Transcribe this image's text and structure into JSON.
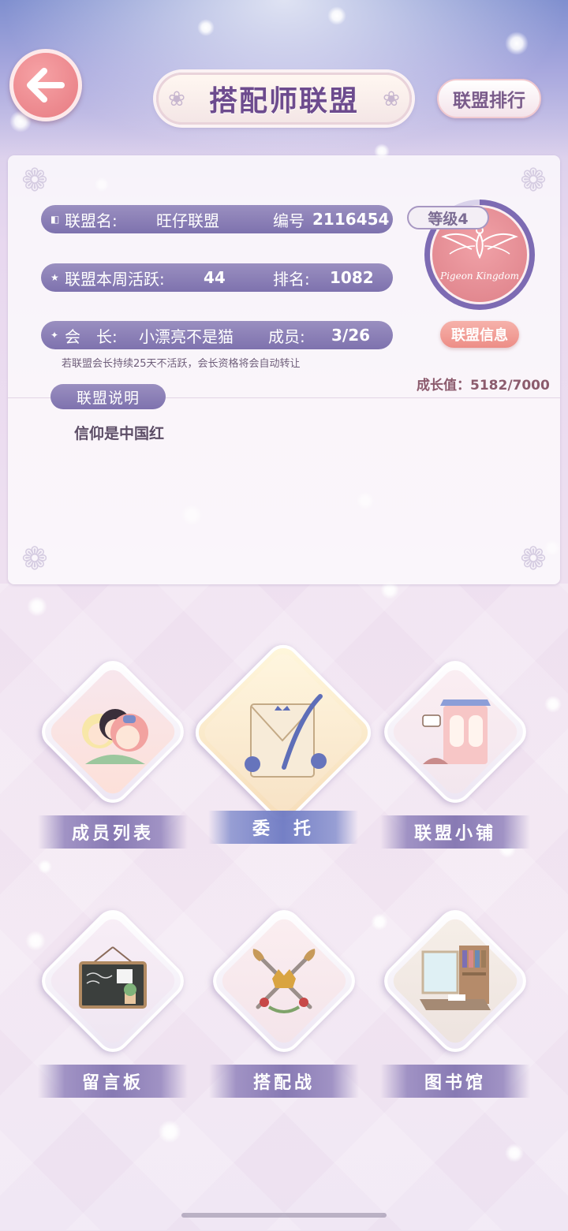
{
  "header": {
    "title": "搭配师联盟",
    "rank_button": "联盟排行"
  },
  "alliance": {
    "name_label": "联盟名:",
    "name_value": "旺仔联盟",
    "id_label": "编号",
    "id_value": "2116454",
    "weekly_label": "联盟本周活跃:",
    "weekly_value": "44",
    "rank_label": "排名:",
    "rank_value": "1082",
    "leader_label": "会　长:",
    "leader_value": "小漂亮不是猫",
    "members_label": "成员:",
    "members_value": "3/26",
    "note": "若联盟会长持续25天不活跃，会长资格将会自动转让",
    "level": "等级4",
    "emblem_text": "Pigeon Kingdom",
    "info_button": "联盟信息",
    "growth": "成长值：5182/7000",
    "desc_tag": "联盟说明",
    "desc_text": "信仰是中国红"
  },
  "tiles": [
    {
      "label": "成员列表"
    },
    {
      "label": "委　托"
    },
    {
      "label": "联盟小铺"
    },
    {
      "label": "留言板"
    },
    {
      "label": "搭配战"
    },
    {
      "label": "图书馆"
    }
  ],
  "colors": {
    "pill": "#8a7fb8",
    "accent_pink": "#ed8d86",
    "back_button": "#e77b82"
  }
}
